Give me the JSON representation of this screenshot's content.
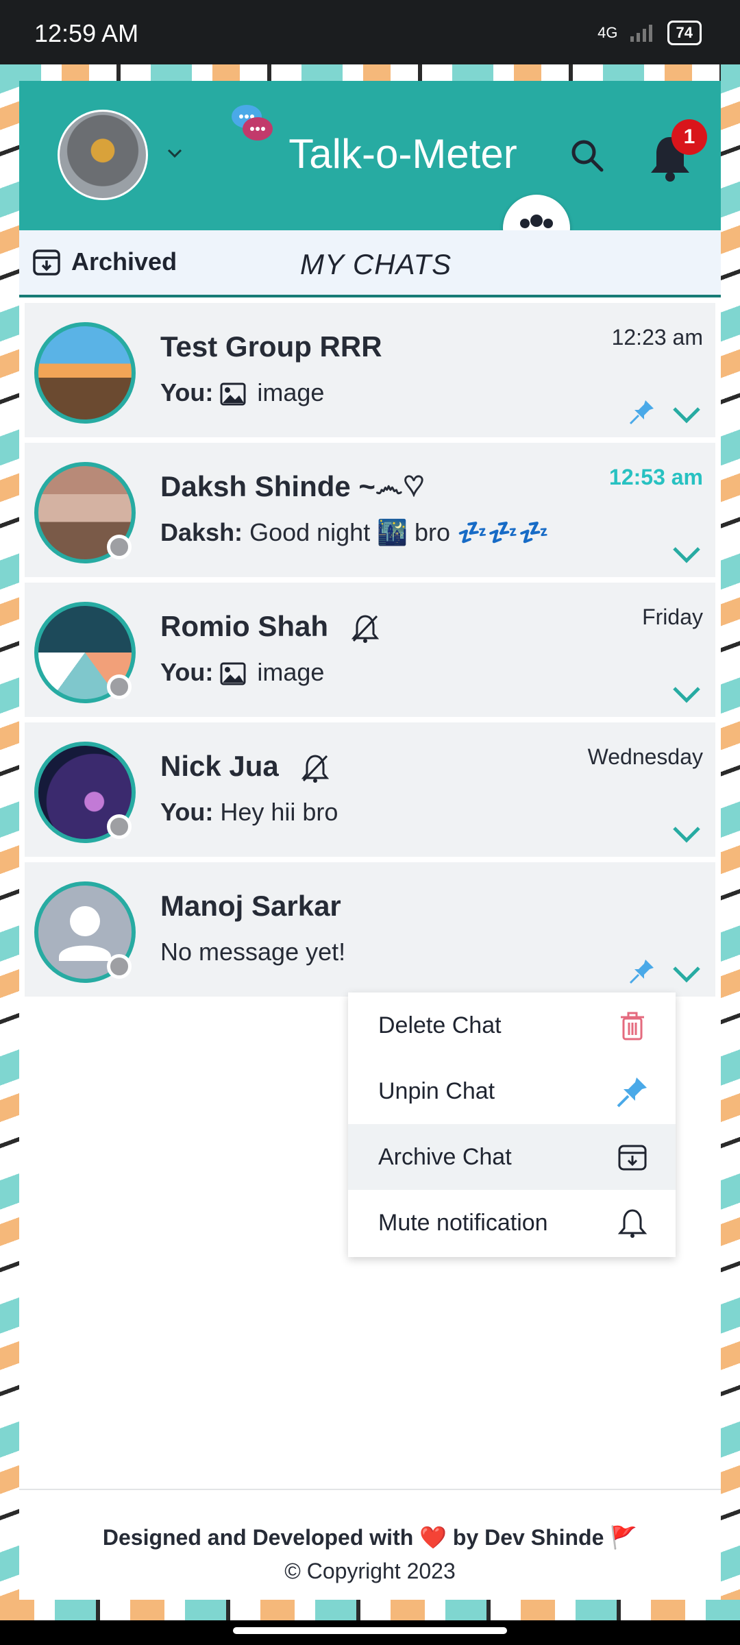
{
  "status_bar": {
    "time": "12:59 AM",
    "network": "4G",
    "battery": "74"
  },
  "header": {
    "title": "Talk-o-Meter",
    "notification_count": "1",
    "accent_color": "#27aba2"
  },
  "tabs": {
    "archived_label": "Archived",
    "my_chats_label": "MY CHATS"
  },
  "chats": [
    {
      "name": "Test Group RRR",
      "sender": "You:",
      "message": "image",
      "has_image_icon": true,
      "time": "12:23 am",
      "pinned": true,
      "muted": false,
      "active_time": false
    },
    {
      "name": "Daksh Shinde ~෴♡",
      "sender": "Daksh:",
      "message": "Good night 🌃 bro 💤💤💤",
      "has_image_icon": false,
      "time": "12:53 am",
      "pinned": false,
      "muted": false,
      "active_time": true
    },
    {
      "name": "Romio Shah",
      "sender": "You:",
      "message": "image",
      "has_image_icon": true,
      "time": "Friday",
      "pinned": false,
      "muted": true,
      "active_time": false
    },
    {
      "name": "Nick Jua",
      "sender": "You:",
      "message": "Hey hii bro",
      "has_image_icon": false,
      "time": "Wednesday",
      "pinned": false,
      "muted": true,
      "active_time": false
    },
    {
      "name": "Manoj Sarkar",
      "sender": "",
      "message": "No message yet!",
      "has_image_icon": false,
      "time": "",
      "pinned": true,
      "muted": false,
      "active_time": false
    }
  ],
  "menu": {
    "items": [
      {
        "label": "Delete Chat",
        "icon": "trash-icon"
      },
      {
        "label": "Unpin Chat",
        "icon": "pin-icon"
      },
      {
        "label": "Archive Chat",
        "icon": "archive-icon"
      },
      {
        "label": "Mute notification",
        "icon": "bell-icon"
      }
    ]
  },
  "footer": {
    "line1": "Designed and Developed with ❤️ by Dev Shinde 🚩",
    "line2": "© Copyright 2023"
  }
}
